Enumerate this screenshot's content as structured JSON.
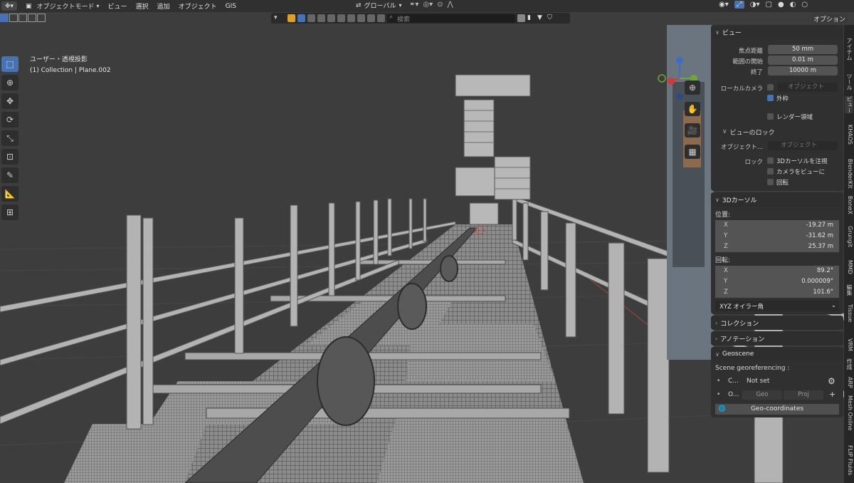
{
  "header": {
    "mode": "オブジェクトモード",
    "menus": [
      "ビュー",
      "選択",
      "追加",
      "オブジェクト",
      "GIS"
    ],
    "transform_orientation": "グローバル",
    "options_button": "オプション"
  },
  "toolbar2": {
    "search_placeholder": "検索"
  },
  "viewport": {
    "view_name": "ユーザー・透視投影",
    "collection_line": "(1) Collection | Plane.002"
  },
  "sidebar_tabs": [
    "アイテム",
    "ツール",
    "ビュー",
    "KHAOS",
    "BlenderKit",
    "BoneX",
    "Grungit",
    "MMD",
    "編集",
    "Tissue",
    "VRM",
    "作成",
    "ARP",
    "Mesh Online",
    "FLIP Fluids"
  ],
  "panel": {
    "view": {
      "title": "ビュー",
      "focal_label": "焦点距離",
      "focal_value": "50 mm",
      "clip_start_label": "範囲の開始",
      "clip_start_value": "0.01 m",
      "clip_end_label": "終了",
      "clip_end_value": "10000 m",
      "local_camera_label": "ローカルカメラ",
      "local_camera_placeholder": "オブジェクト",
      "border_label": "外枠",
      "render_region_label": "レンダー領域",
      "view_lock_title": "ビューのロック",
      "lock_object_label": "オブジェクト...",
      "lock_object_placeholder": "オブジェクト",
      "lock_label": "ロック",
      "lock_cursor": "3Dカーソルを注視",
      "lock_camera": "カメラをビューに",
      "lock_rotation": "回転"
    },
    "cursor": {
      "title": "3Dカーソル",
      "location_label": "位置:",
      "x_label": "X",
      "x": "-19.27 m",
      "y_label": "Y",
      "y": "-31.62 m",
      "z_label": "Z",
      "z": "25.37 m",
      "rotation_label": "回転:",
      "rx": "89.2°",
      "ry": "0.000009°",
      "rz": "101.6°",
      "rotation_mode": "XYZ オイラー角"
    },
    "collection": {
      "title": "コレクション"
    },
    "annotation": {
      "title": "アノテーション"
    },
    "geoscene": {
      "title": "Geoscene",
      "georef_label": "Scene georeferencing :",
      "crs_short": "C...",
      "crs_value": "Not set",
      "origin_short": "O...",
      "geo_btn": "Geo",
      "proj_btn": "Proj",
      "geo_coords_btn": "Geo-coordinates"
    }
  },
  "colors": {
    "accent": "#4772b3",
    "bg_viewport": "#3d3d3d",
    "panel_bg": "#303030"
  }
}
